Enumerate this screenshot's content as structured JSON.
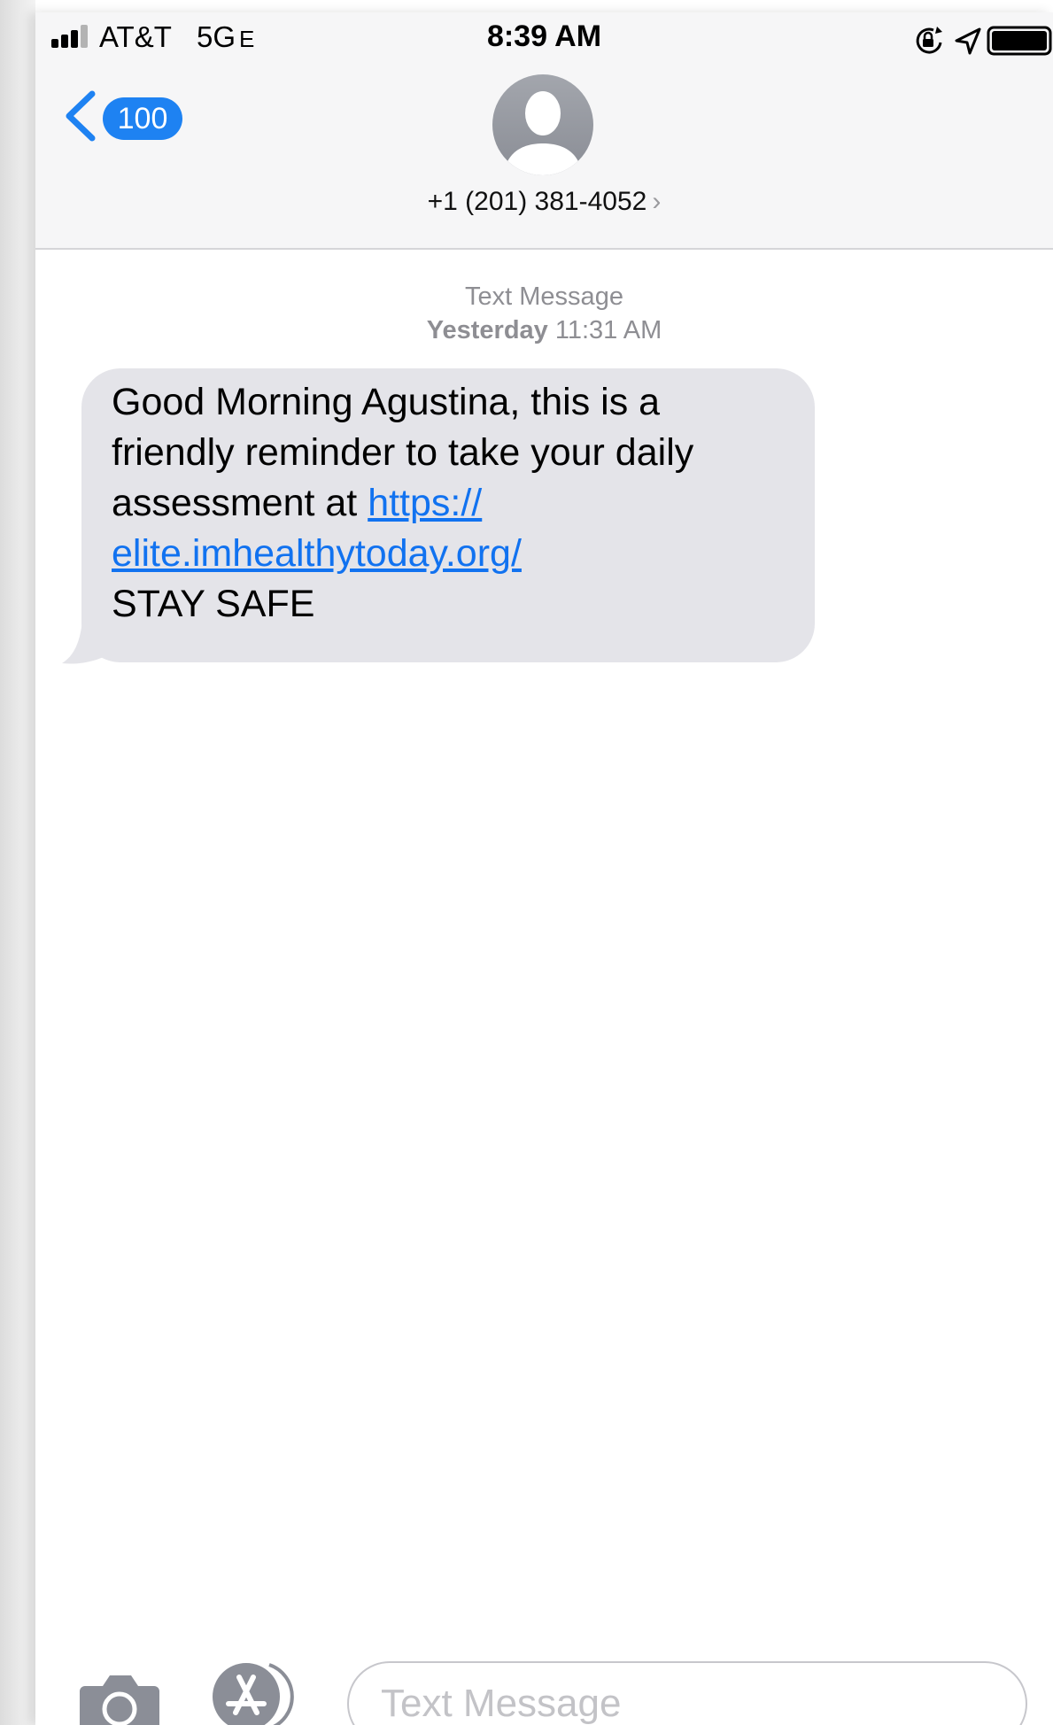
{
  "status_bar": {
    "carrier": "AT&T",
    "network": "5G",
    "network_suffix": "E",
    "time": "8:39 AM",
    "icons": [
      "signal-bars-icon",
      "rotation-lock-icon",
      "location-arrow-icon",
      "battery-icon"
    ]
  },
  "header": {
    "back_badge": "100",
    "contact_number": "+1 (201) 381-4052",
    "contact_chevron": "›"
  },
  "thread": {
    "message_type": "Text Message",
    "day": "Yesterday",
    "time": "11:31 AM",
    "message": {
      "text_before_link": "Good Morning Agustina, this is a friendly reminder to take your daily assessment at ",
      "link_line1": "https://",
      "link_line2": "elite.imhealthytoday.org/",
      "text_after_link": "STAY SAFE"
    }
  },
  "input_bar": {
    "placeholder": "Text Message",
    "icons": [
      "camera-icon",
      "app-store-icon",
      "send-arrow-icon"
    ]
  },
  "colors": {
    "accent_blue": "#1E82F2",
    "link_blue": "#1172F0",
    "bubble_gray": "#E4E4E9",
    "send_green": "#00C236",
    "meta_gray": "#8E8E93"
  }
}
